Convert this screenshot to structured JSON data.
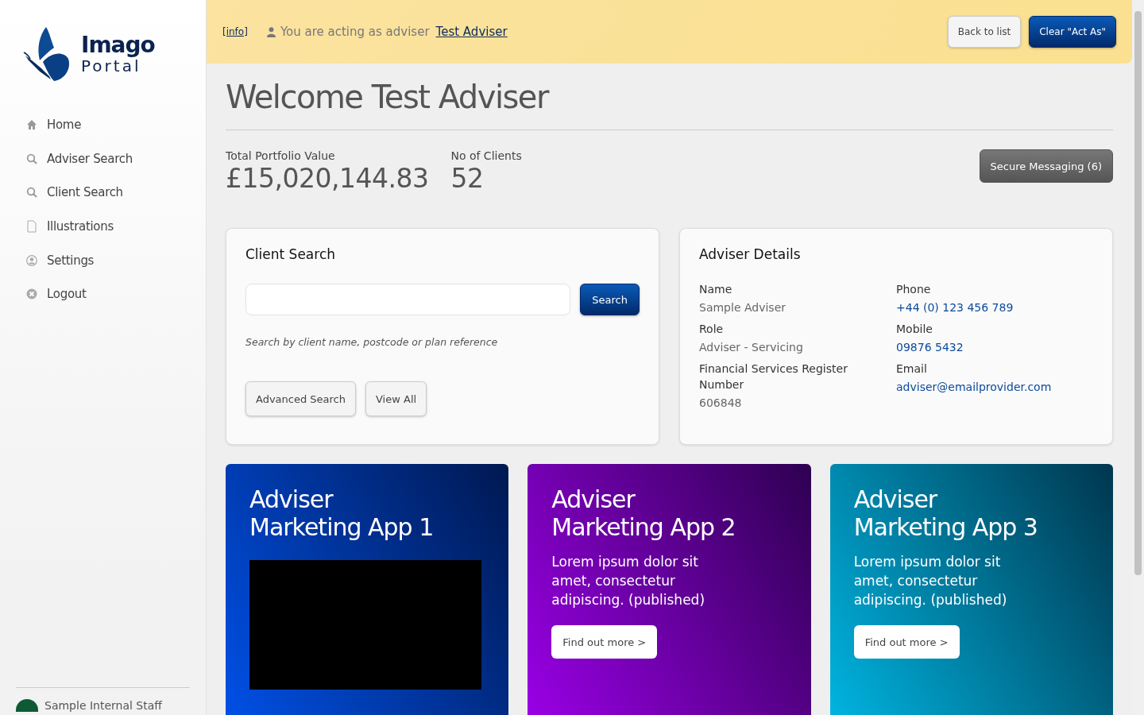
{
  "logo": {
    "name": "Imago",
    "sub": "Portal"
  },
  "nav": [
    {
      "label": "Home",
      "kind": "home"
    },
    {
      "label": "Adviser Search",
      "kind": "search"
    },
    {
      "label": "Client Search",
      "kind": "search"
    },
    {
      "label": "Illustrations",
      "kind": "file"
    },
    {
      "label": "Settings",
      "kind": "user"
    },
    {
      "label": "Logout",
      "kind": "close"
    }
  ],
  "user": {
    "name": "Sample Internal Staff"
  },
  "banner": {
    "info": "[info]",
    "message": "You are acting as adviser",
    "adviser": "Test Adviser",
    "buttons": [
      {
        "label": "Back to list",
        "kind": "secondary"
      },
      {
        "label": "Clear \"Act As\"",
        "kind": "primary"
      }
    ]
  },
  "title": "Welcome Test Adviser",
  "stats": [
    {
      "label": "Total Portfolio Value",
      "value": "£15,020,144.83"
    },
    {
      "label": "No of Clients",
      "value": "52"
    }
  ],
  "messaging_button": "Secure Messaging (6)",
  "client_search": {
    "title": "Client Search",
    "button": "Search",
    "hint": "Search by client name, postcode or plan reference",
    "buttons": [
      "Advanced Search",
      "View All"
    ]
  },
  "adviser_details": {
    "title": "Adviser Details",
    "columns": [
      [
        {
          "label": "Name",
          "value": "Sample Adviser",
          "kind": "text"
        },
        {
          "label": "Role",
          "value": "Adviser - Servicing",
          "kind": "text"
        },
        {
          "label": "Financial Services Register Number",
          "value": "606848",
          "kind": "text"
        }
      ],
      [
        {
          "label": "Phone",
          "value": "+44 (0) 123 456 789",
          "kind": "link"
        },
        {
          "label": "Mobile",
          "value": "09876 5432",
          "kind": "link"
        },
        {
          "label": "Email",
          "value": "adviser@emailprovider.com",
          "kind": "link"
        }
      ]
    ]
  },
  "apps": [
    {
      "title": [
        "Adviser",
        "Marketing App 1"
      ],
      "kind": "video",
      "color": "#0050e6"
    },
    {
      "title": [
        "Adviser",
        "Marketing App 2"
      ],
      "kind": "text",
      "color": "#9a00e6",
      "body": "Lorem ipsum dolor sit amet, consectetur adipiscing. (published)",
      "button": "Find out more >"
    },
    {
      "title": [
        "Adviser",
        "Marketing App 3"
      ],
      "kind": "text",
      "color": "#00b4e0",
      "body": "Lorem ipsum dolor sit amet, consectetur adipiscing. (published)",
      "button": "Find out more >"
    }
  ]
}
